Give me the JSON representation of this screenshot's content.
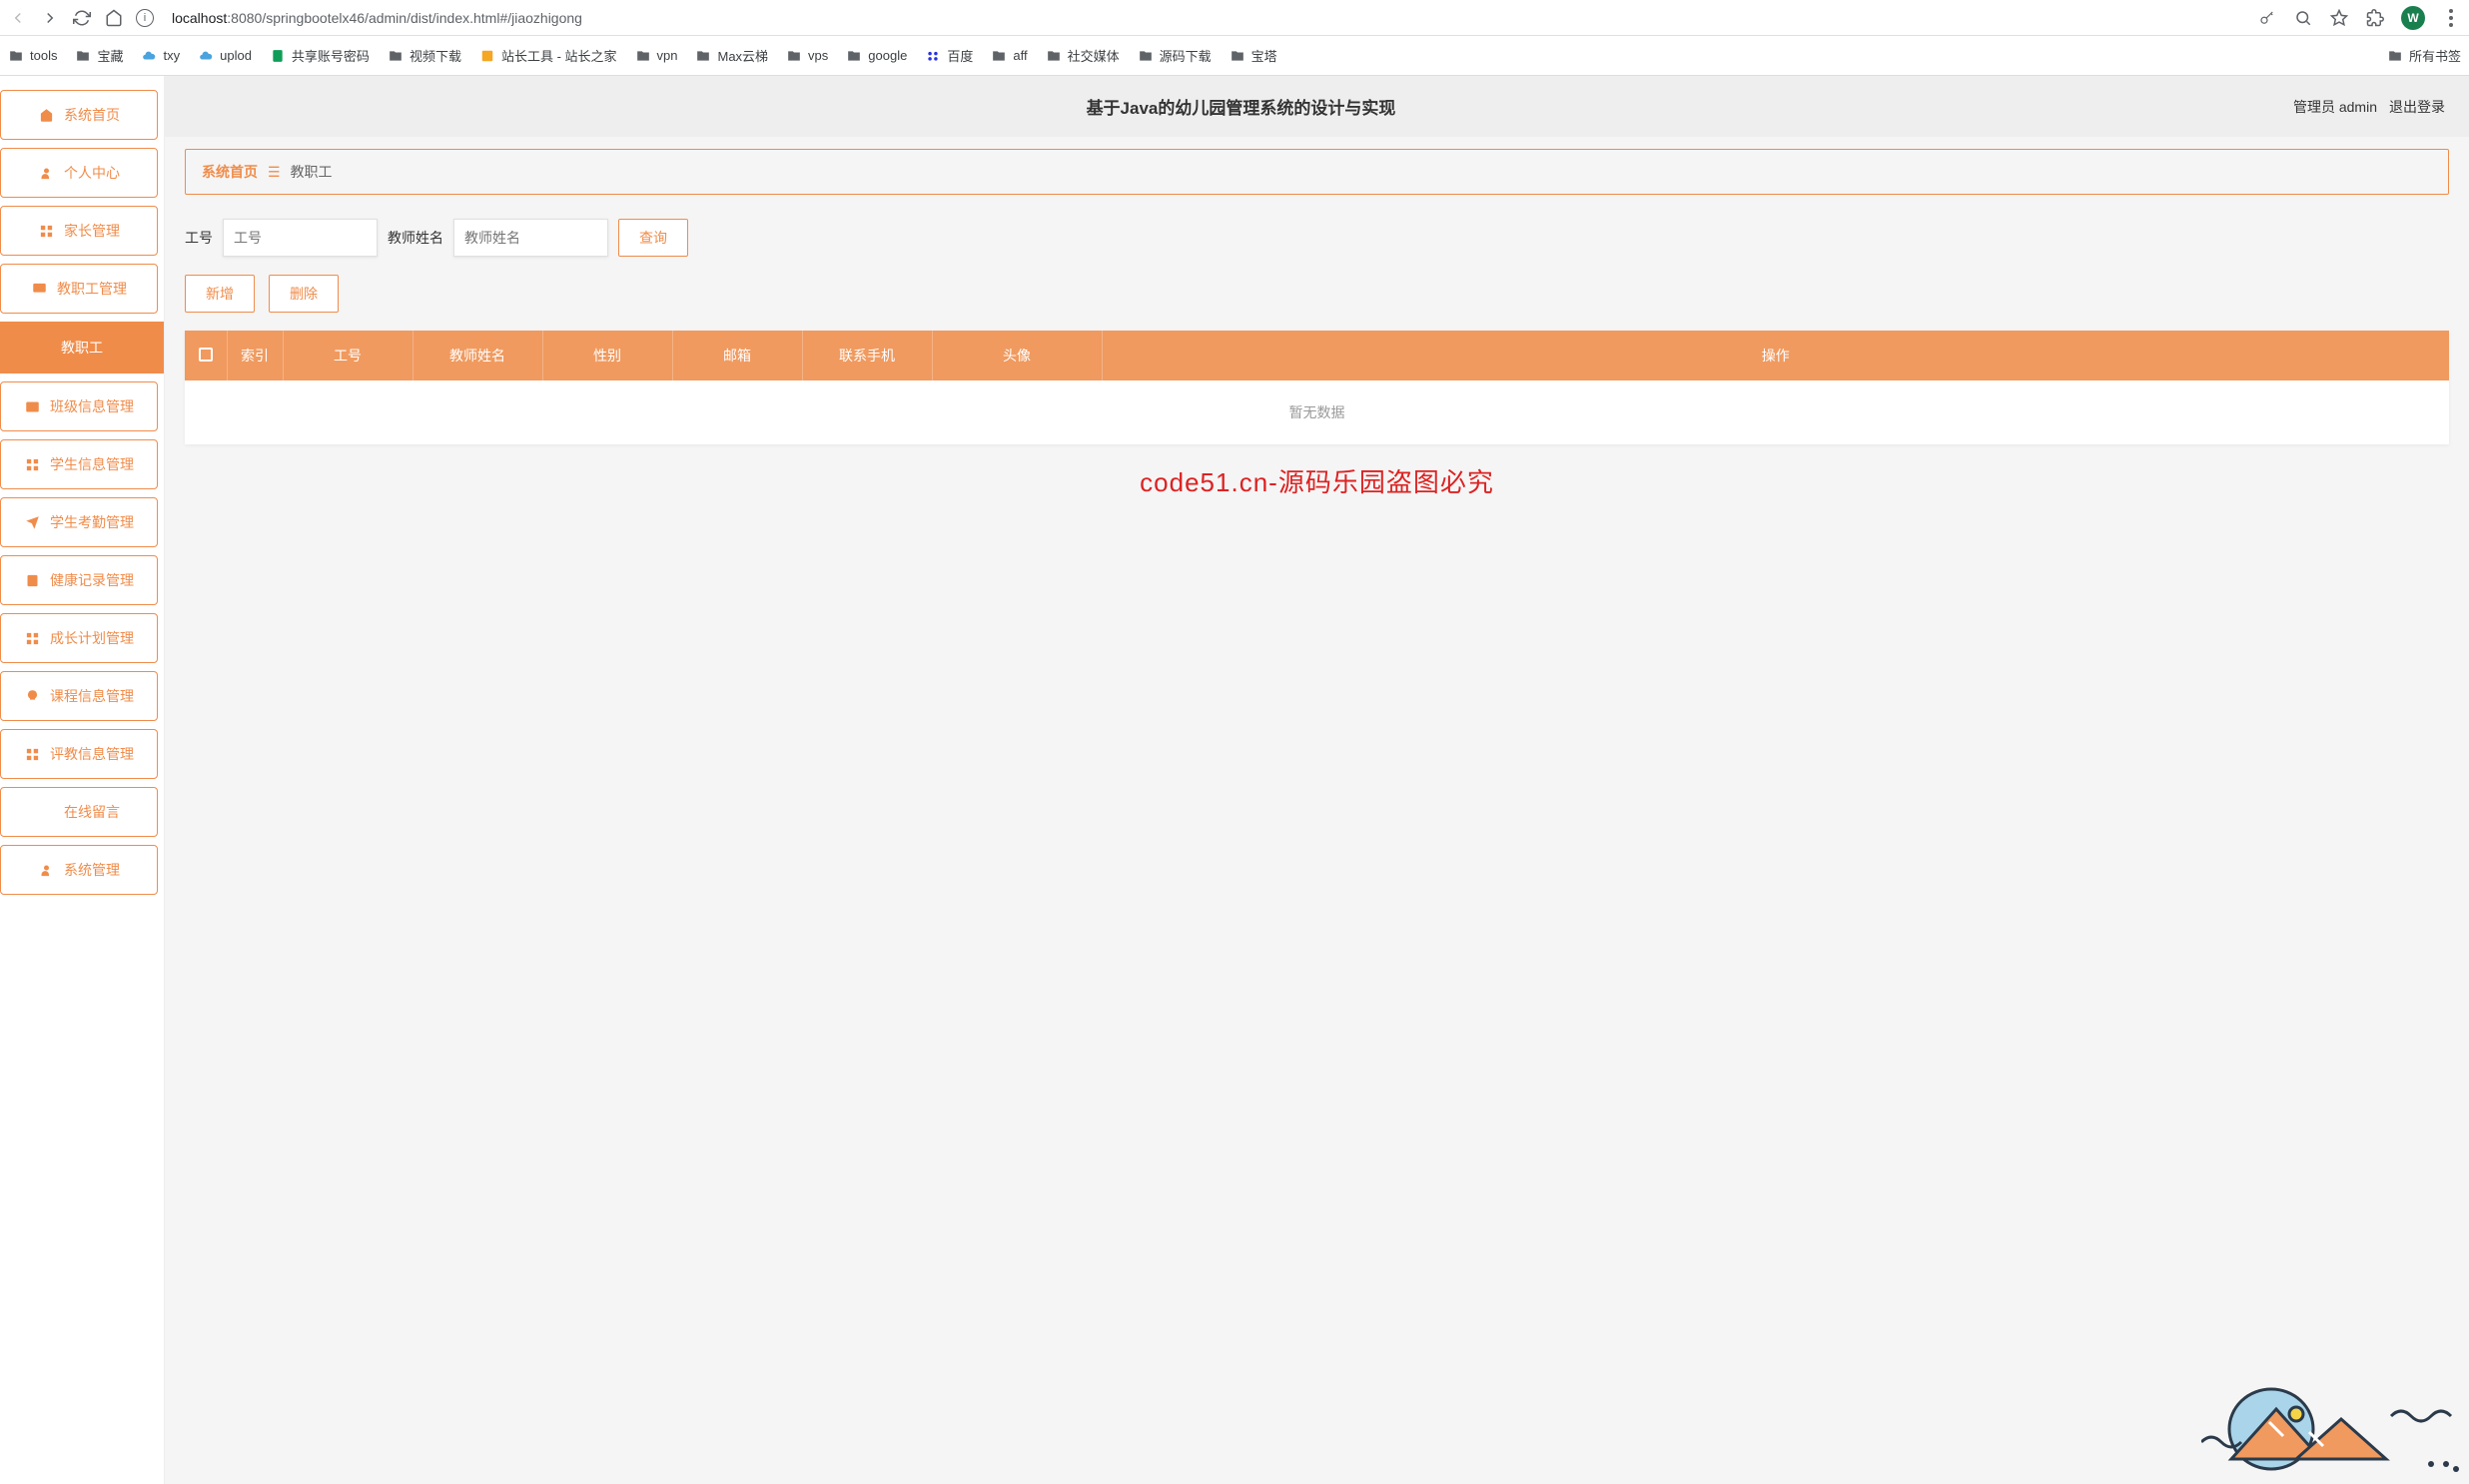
{
  "browser": {
    "url_host": "localhost",
    "url_port": ":8080",
    "url_path": "/springbootelx46/admin/dist/index.html#/jiaozhigong",
    "avatar_letter": "W"
  },
  "bookmarks": [
    {
      "label": "tools",
      "type": "folder"
    },
    {
      "label": "宝藏",
      "type": "folder"
    },
    {
      "label": "txy",
      "type": "cloud"
    },
    {
      "label": "uplod",
      "type": "cloud"
    },
    {
      "label": "共享账号密码",
      "type": "sheet"
    },
    {
      "label": "视频下载",
      "type": "folder"
    },
    {
      "label": "站长工具 - 站长之家",
      "type": "site"
    },
    {
      "label": "vpn",
      "type": "folder"
    },
    {
      "label": "Max云梯",
      "type": "folder"
    },
    {
      "label": "vps",
      "type": "folder"
    },
    {
      "label": "google",
      "type": "folder"
    },
    {
      "label": "百度",
      "type": "baidu"
    },
    {
      "label": "aff",
      "type": "folder"
    },
    {
      "label": "社交媒体",
      "type": "folder"
    },
    {
      "label": "源码下载",
      "type": "folder"
    },
    {
      "label": "宝塔",
      "type": "folder"
    }
  ],
  "bookmarks_right": {
    "label": "所有书签"
  },
  "sidebar": {
    "items": [
      {
        "label": "系统首页",
        "icon": "home"
      },
      {
        "label": "个人中心",
        "icon": "user"
      },
      {
        "label": "家长管理",
        "icon": "grid"
      },
      {
        "label": "教职工管理",
        "icon": "monitor"
      },
      {
        "label": "班级信息管理",
        "icon": "mail"
      },
      {
        "label": "学生信息管理",
        "icon": "grid"
      },
      {
        "label": "学生考勤管理",
        "icon": "plane"
      },
      {
        "label": "健康记录管理",
        "icon": "note"
      },
      {
        "label": "成长计划管理",
        "icon": "grid"
      },
      {
        "label": "课程信息管理",
        "icon": "bulb"
      },
      {
        "label": "评教信息管理",
        "icon": "grid"
      },
      {
        "label": "在线留言",
        "icon": "chart"
      },
      {
        "label": "系统管理",
        "icon": "user"
      }
    ],
    "submenu": {
      "label": "教职工"
    }
  },
  "header": {
    "title": "基于Java的幼儿园管理系统的设计与实现",
    "role_user": "管理员 admin",
    "logout": "退出登录"
  },
  "breadcrumb": {
    "home": "系统首页",
    "current": "教职工"
  },
  "search": {
    "field1_label": "工号",
    "field1_placeholder": "工号",
    "field2_label": "教师姓名",
    "field2_placeholder": "教师姓名",
    "query_btn": "查询"
  },
  "actions": {
    "add": "新增",
    "delete": "删除"
  },
  "table": {
    "columns": [
      "索引",
      "工号",
      "教师姓名",
      "性别",
      "邮箱",
      "联系手机",
      "头像",
      "操作"
    ],
    "empty_text": "暂无数据"
  },
  "watermark": "code51.cn-源码乐园盗图必究"
}
